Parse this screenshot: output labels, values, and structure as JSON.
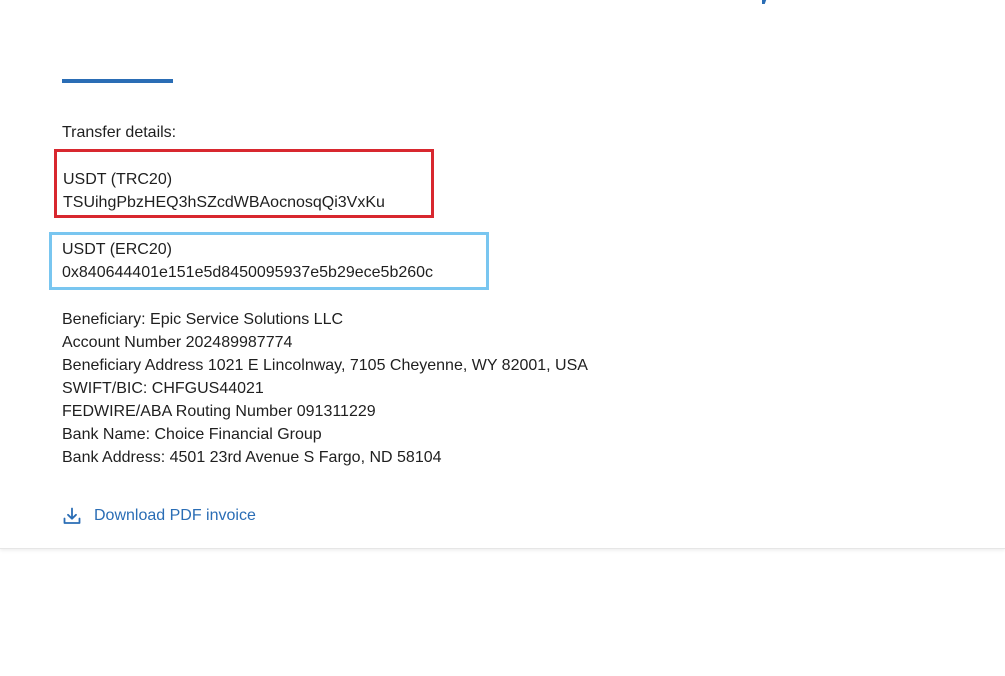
{
  "transfer": {
    "label": "Transfer details:",
    "trc20": {
      "title": "USDT (TRC20)",
      "address": "TSUihgPbzHEQ3hSZcdWBAocnosqQi3VxKu"
    },
    "erc20": {
      "title": "USDT (ERC20)",
      "address": "0x840644401e151e5d8450095937e5b29ece5b260c"
    }
  },
  "bank": {
    "beneficiary": "Beneficiary: Epic Service Solutions LLC",
    "account_number": "Account Number 202489987774",
    "beneficiary_address": "Beneficiary Address 1021 E Lincolnway, 7105 Cheyenne, WY 82001, USA",
    "swift": "SWIFT/BIC: CHFGUS44021",
    "routing": "FEDWIRE/ABA Routing Number 091311229",
    "bank_name": "Bank Name: Choice Financial Group",
    "bank_address": "Bank Address: 4501 23rd Avenue S Fargo, ND 58104"
  },
  "download": {
    "label": "Download PDF invoice",
    "icon": "download-icon"
  },
  "colors": {
    "accent": "#2a6db5",
    "trc_highlight": "#d8282f",
    "erc_highlight": "#79c6f0"
  }
}
